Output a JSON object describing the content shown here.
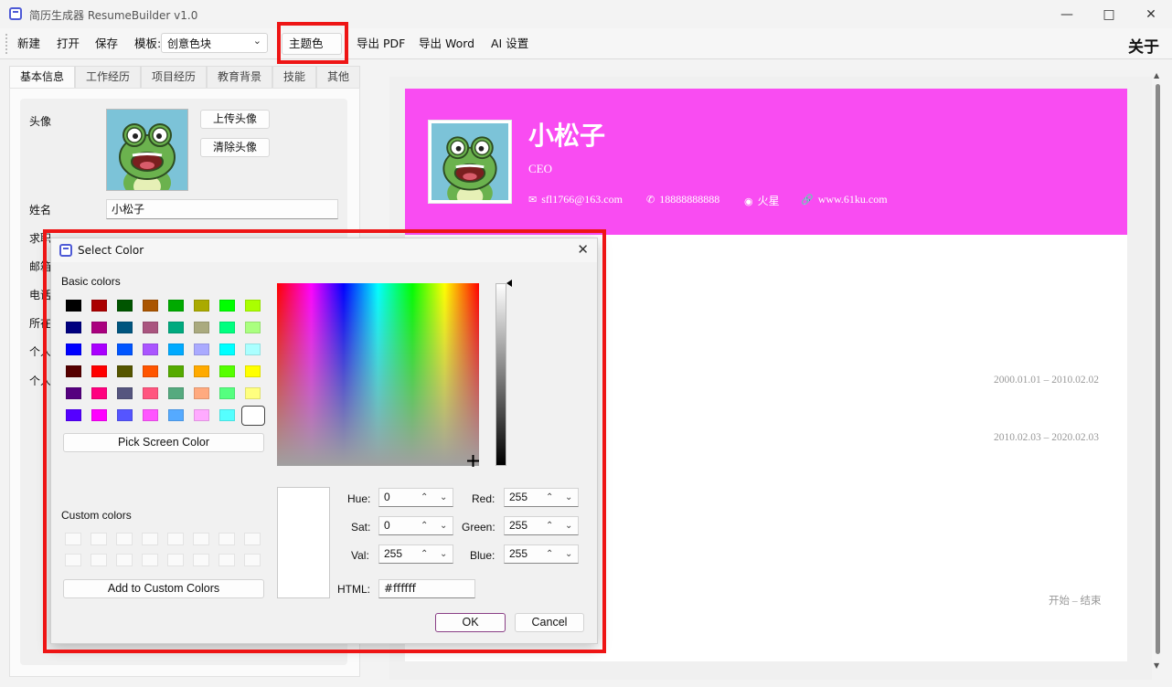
{
  "window": {
    "title": "简历生成器 ResumeBuilder  v1.0"
  },
  "toolbar": {
    "new": "新建",
    "open": "打开",
    "save": "保存",
    "template_label": "模板:",
    "template_value": "创意色块",
    "theme_color": "主题色",
    "export_pdf": "导出 PDF",
    "export_word": "导出 Word",
    "ai_settings": "AI 设置",
    "about": "关于"
  },
  "tabs": [
    "基本信息",
    "工作经历",
    "项目经历",
    "教育背景",
    "技能",
    "其他"
  ],
  "form": {
    "avatar_label": "头像",
    "upload_avatar": "上传头像",
    "clear_avatar": "清除头像",
    "name_label": "姓名",
    "name_value": "小松子",
    "partial_labels": [
      "求职",
      "邮箱",
      "电话",
      "所在",
      "个人",
      "个人"
    ]
  },
  "preview": {
    "name": "小松子",
    "title": "CEO",
    "email": "sfl1766@163.com",
    "phone": "18888888888",
    "location": "火星",
    "website": "www.61ku.com",
    "theme_color": "#f94cf2",
    "dates": [
      "2000.01.01 – 2010.02.02",
      "2010.02.03 – 2020.02.03",
      "开始 – 结束"
    ]
  },
  "color_dialog": {
    "title": "Select Color",
    "basic_colors_label": "Basic colors",
    "basic_colors": [
      [
        "#000000",
        "#aa0000",
        "#005500",
        "#aa5500",
        "#00aa00",
        "#aaaa00",
        "#00ff00",
        "#aaff00"
      ],
      [
        "#00007f",
        "#aa007f",
        "#00557f",
        "#aa557f",
        "#00aa7f",
        "#aaaa7f",
        "#00ff7f",
        "#aaff7f"
      ],
      [
        "#0000ff",
        "#aa00ff",
        "#0055ff",
        "#aa55ff",
        "#00aaff",
        "#aaaaff",
        "#00ffff",
        "#aaffff"
      ],
      [
        "#550000",
        "#ff0000",
        "#555500",
        "#ff5500",
        "#55aa00",
        "#ffaa00",
        "#55ff00",
        "#ffff00"
      ],
      [
        "#55007f",
        "#ff007f",
        "#55557f",
        "#ff557f",
        "#55aa7f",
        "#ffaa7f",
        "#55ff7f",
        "#ffff7f"
      ],
      [
        "#5500ff",
        "#ff00ff",
        "#5555ff",
        "#ff55ff",
        "#55aaff",
        "#ffaaff",
        "#55ffff",
        "#ffffff"
      ]
    ],
    "pick_screen_color": "Pick Screen Color",
    "custom_colors_label": "Custom colors",
    "add_custom": "Add to Custom Colors",
    "hue_label": "Hue:",
    "hue": "0",
    "sat_label": "Sat:",
    "sat": "0",
    "val_label": "Val:",
    "val": "255",
    "red_label": "Red:",
    "red": "255",
    "green_label": "Green:",
    "green": "255",
    "blue_label": "Blue:",
    "blue": "255",
    "html_label": "HTML:",
    "html": "#ffffff",
    "ok": "OK",
    "cancel": "Cancel",
    "current_color": "#ffffff"
  }
}
